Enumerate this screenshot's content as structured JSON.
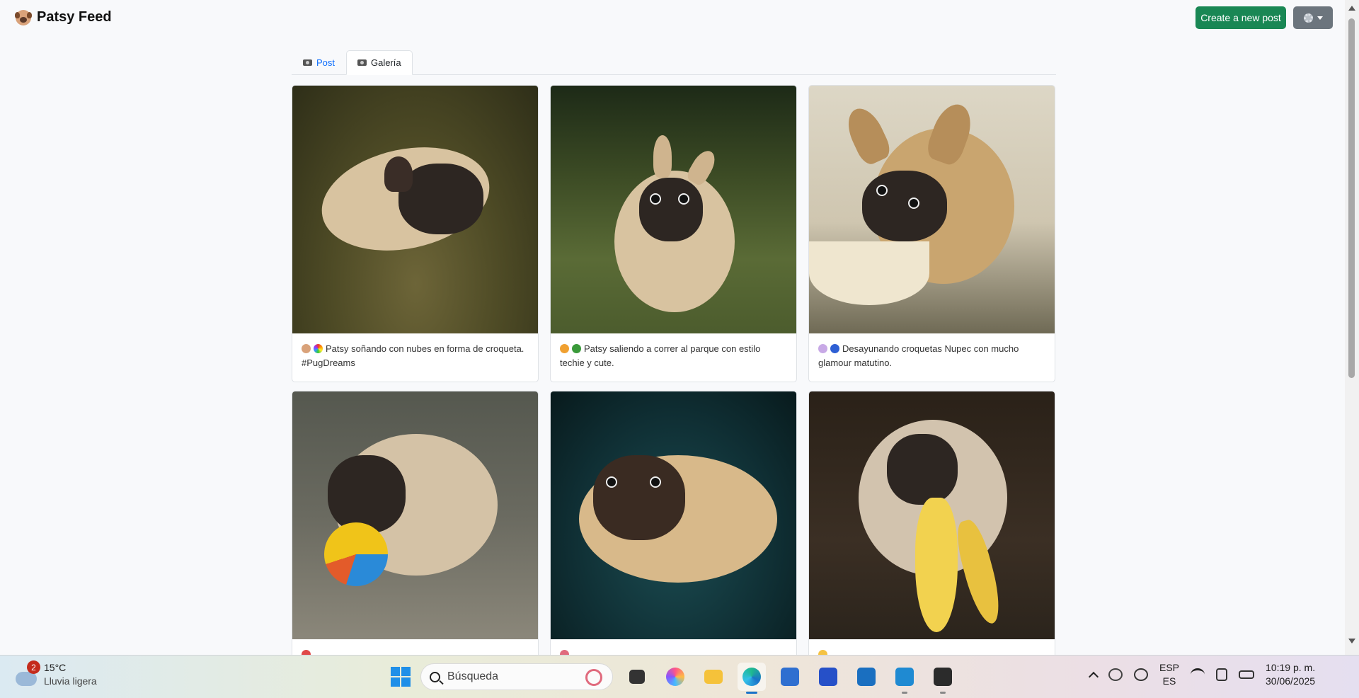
{
  "app": {
    "title": "Patsy Feed"
  },
  "header": {
    "create_label": "Create a new post"
  },
  "tabs": [
    {
      "label": "Post",
      "active": false
    },
    {
      "label": "Galería",
      "active": true
    }
  ],
  "gallery": [
    {
      "caption": "Patsy soñando con nubes en forma de croqueta. #PugDreams",
      "emojis": [
        "dog-face-icon",
        "rainbow-icon"
      ]
    },
    {
      "caption": "Patsy saliendo a correr al parque con estilo techie y cute.",
      "emojis": [
        "runner-icon",
        "tree-icon"
      ]
    },
    {
      "caption": "Desayunando croquetas Nupec con mucho glamour matutino.",
      "emojis": [
        "plate-icon",
        "bowl-icon"
      ]
    },
    {
      "caption": "",
      "emojis": [
        "pin-icon"
      ]
    },
    {
      "caption": "",
      "emojis": [
        "splash-icon"
      ]
    },
    {
      "caption": "",
      "emojis": [
        "sun-icon"
      ]
    }
  ],
  "taskbar": {
    "weather": {
      "temp": "15°C",
      "desc": "Lluvia ligera",
      "badge": "2"
    },
    "search_placeholder": "Búsqueda",
    "language": {
      "line1": "ESP",
      "line2": "ES"
    },
    "clock": {
      "time": "10:19 p. m.",
      "date": "30/06/2025"
    }
  },
  "colors": {
    "primary_green": "#198754",
    "link_blue": "#0d6efd",
    "secondary_gray": "#6c757d"
  }
}
